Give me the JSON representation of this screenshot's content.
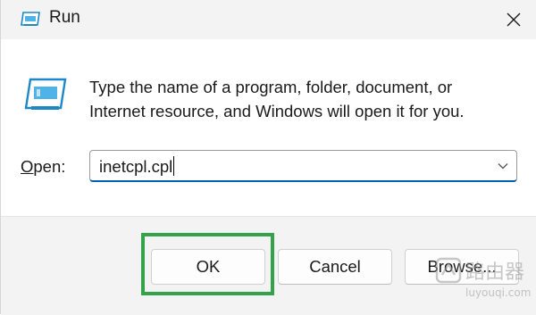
{
  "window": {
    "title": "Run",
    "title_icon": "run-app-icon",
    "close_icon": "close-icon"
  },
  "content": {
    "icon": "run-app-icon",
    "description_line1": "Type the name of a program, folder, document, or",
    "description_line2": "Internet resource, and Windows will open it for you.",
    "open_label_mnemonic": "O",
    "open_label_rest": "pen:",
    "input_value": "inetcpl.cpl",
    "dropdown_icon": "chevron-down-icon"
  },
  "buttons": {
    "ok": "OK",
    "cancel": "Cancel",
    "browse": "Browse..."
  },
  "highlight": {
    "target": "ok-button",
    "color": "#35a24a"
  },
  "watermark": {
    "text_cn": "路由器",
    "text_en": "luyouqi.com"
  },
  "colors": {
    "accent": "#005fb8",
    "titlebar": "#f3f3f3",
    "footer": "#f3f3f3"
  }
}
